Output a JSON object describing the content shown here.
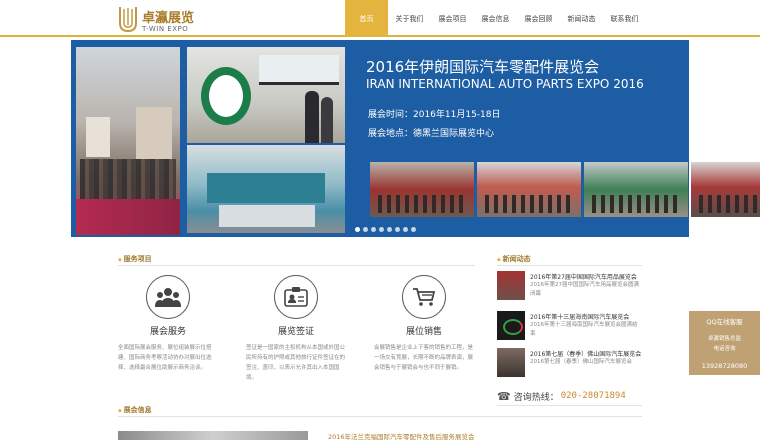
{
  "brand": {
    "name_cn": "卓瀛展览",
    "name_en": "T-WIN EXPO",
    "accent_color": "#e3b53e",
    "banner_color": "#1c5da3"
  },
  "nav": {
    "items": [
      {
        "label": "首页",
        "active": true
      },
      {
        "label": "关于我们"
      },
      {
        "label": "展会项目"
      },
      {
        "label": "展会信息"
      },
      {
        "label": "展会回顾"
      },
      {
        "label": "新闻动态"
      },
      {
        "label": "联系我们"
      }
    ]
  },
  "banner": {
    "title_cn": "2016年伊朗国际汽车零配件展览会",
    "title_en": "IRAN INTERNATIONAL AUTO PARTS EXPO 2016",
    "time": "展会时间：2016年11月15-18日",
    "venue": "展会地点：德黑兰国际展览中心",
    "slide_count": 8,
    "active_slide": 1
  },
  "services": {
    "heading": "服务项目",
    "items": [
      {
        "icon": "group-users-icon",
        "title": "展会服务",
        "desc": "全面国际展会服务、展位组装展示位搭建、国际商务考察活动协办对展出位选择、选择最合展位助展示商务洽谈。"
      },
      {
        "icon": "id-card-icon",
        "title": "展览签证",
        "desc": "签证是一国家的主权机构从本国或外国公民所持有的护照或其他旅行证件签证在的签注、盖印，以表示允许其出入本国国境。"
      },
      {
        "icon": "shopping-cart-icon",
        "title": "展位销售",
        "desc": "会展销售是企业上下客的销售的工程，是一场交有竞展，长期不断的品牌表演，展会销售与于展销会与也不同于展销。"
      }
    ]
  },
  "news": {
    "heading": "新闻动态",
    "items": [
      {
        "title": "2016年第27届中国国际汽车用品展览会",
        "summary": "2016年第27届中国国际汽车用品展览会圆满闭幕"
      },
      {
        "title": "2016年第十三届海南国际汽车展览会",
        "summary": "2016年第十三届海南国际汽车展览会圆满结束"
      },
      {
        "title": "2016第七届（春季）佛山国际汽车展览会",
        "summary": "2016第七届（春季）佛山国际汽车展览会"
      }
    ],
    "hotline_label": "咨询热线：",
    "hotline_number": "020-28071894"
  },
  "exhibition": {
    "heading": "展会信息",
    "first_title": "2016年法兰克福国际汽车零配件及售后服务展览会"
  },
  "side_panel": {
    "title": "QQ在线客服",
    "sub1": "卓瀛销售总监",
    "sub2": "电话咨询",
    "phone": "13928728080"
  }
}
